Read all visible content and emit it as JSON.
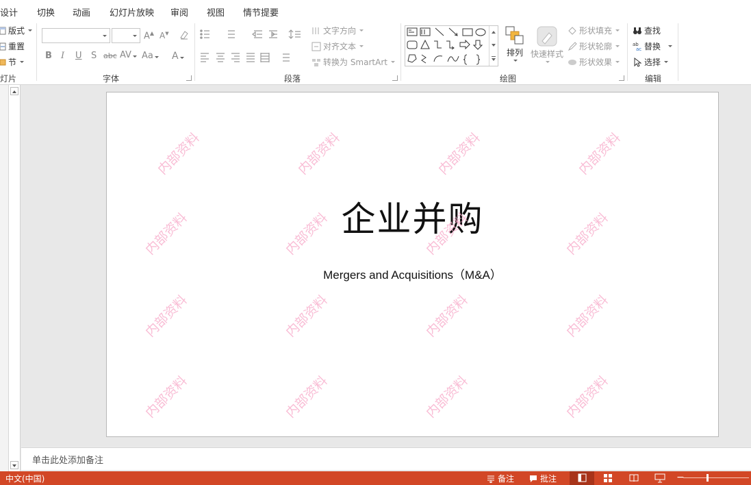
{
  "tabs": [
    "设计",
    "切换",
    "动画",
    "幻灯片放映",
    "审阅",
    "视图",
    "情节提要"
  ],
  "ribbon": {
    "slides_group": {
      "label": "灯片",
      "layout": "版式",
      "reset": "重置",
      "section": "节"
    },
    "font_group": {
      "label": "字体",
      "font_name": "",
      "font_size": ""
    },
    "paragraph_group": {
      "label": "段落",
      "text_direction": "文字方向",
      "align_text": "对齐文本",
      "smartart": "转换为 SmartArt"
    },
    "drawing_group": {
      "label": "绘图",
      "arrange": "排列",
      "quick_styles": "快速样式",
      "shape_fill": "形状填充",
      "shape_outline": "形状轮廓",
      "shape_effects": "形状效果"
    },
    "editing_group": {
      "label": "编辑",
      "find": "查找",
      "replace": "替换",
      "select": "选择"
    }
  },
  "slide": {
    "title": "企业并购",
    "subtitle": "Mergers and Acquisitions（M&A）",
    "watermark": "内部资料"
  },
  "notes_placeholder": "单击此处添加备注",
  "status": {
    "language": "中文(中国)",
    "notes": "备注",
    "comments": "批注"
  },
  "colors": {
    "accent": "#d24726",
    "watermark": "#f7a7c8"
  }
}
